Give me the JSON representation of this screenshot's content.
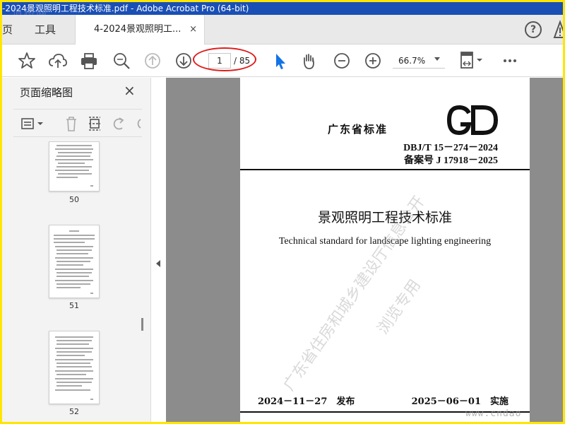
{
  "window": {
    "title": "-2024景观照明工程技术标准.pdf - Adobe Acrobat Pro (64-bit)",
    "watermark_top": "道桥网"
  },
  "tabs": {
    "home": "页",
    "tools": "工具",
    "document": "4-2024景观照明工...",
    "close": "×",
    "help": "?"
  },
  "toolbar": {
    "page_current": "1",
    "page_total": "/ 85",
    "zoom": "66.7%"
  },
  "panel": {
    "title": "页面缩略图",
    "close": "×",
    "thumbnails": [
      {
        "page": "50"
      },
      {
        "page": "51"
      },
      {
        "page": "52"
      }
    ]
  },
  "document": {
    "org": "广东省标准",
    "code": "DBJ/T 15－274－2024",
    "record": "备案号  J 17918－2025",
    "title_cn": "景观照明工程技术标准",
    "title_en": "Technical standard for landscape lighting engineering",
    "issue": "2024－11－27　发布",
    "implement": "2025－06－01　实施",
    "watermark_1": "广东省住房和城乡建设厅信息公开",
    "watermark_2": "浏览专用",
    "watermark_corner": "www.cndao"
  },
  "colors": {
    "titlebar": "#1a4fb5",
    "frame": "#ffe600",
    "accent_select": "#1473e6",
    "annotation": "#e01c1c"
  }
}
